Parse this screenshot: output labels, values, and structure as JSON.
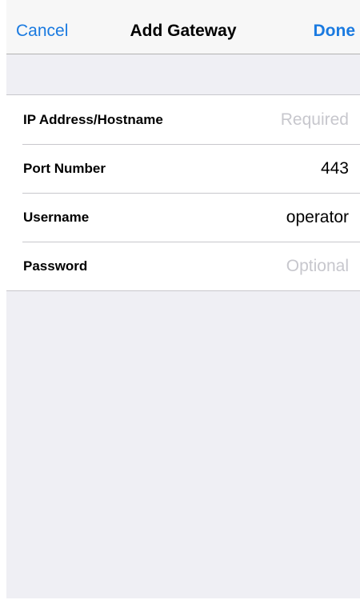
{
  "navbar": {
    "cancel_label": "Cancel",
    "title": "Add Gateway",
    "done_label": "Done"
  },
  "form": {
    "rows": [
      {
        "label": "IP Address/Hostname",
        "value": "",
        "placeholder": "Required"
      },
      {
        "label": "Port Number",
        "value": "443",
        "placeholder": ""
      },
      {
        "label": "Username",
        "value": "operator",
        "placeholder": ""
      },
      {
        "label": "Password",
        "value": "",
        "placeholder": "Optional"
      }
    ]
  },
  "colors": {
    "accent": "#1a7ae0",
    "background": "#efeff4",
    "separator": "#c8c7cc",
    "placeholder": "#c7c7cd"
  }
}
